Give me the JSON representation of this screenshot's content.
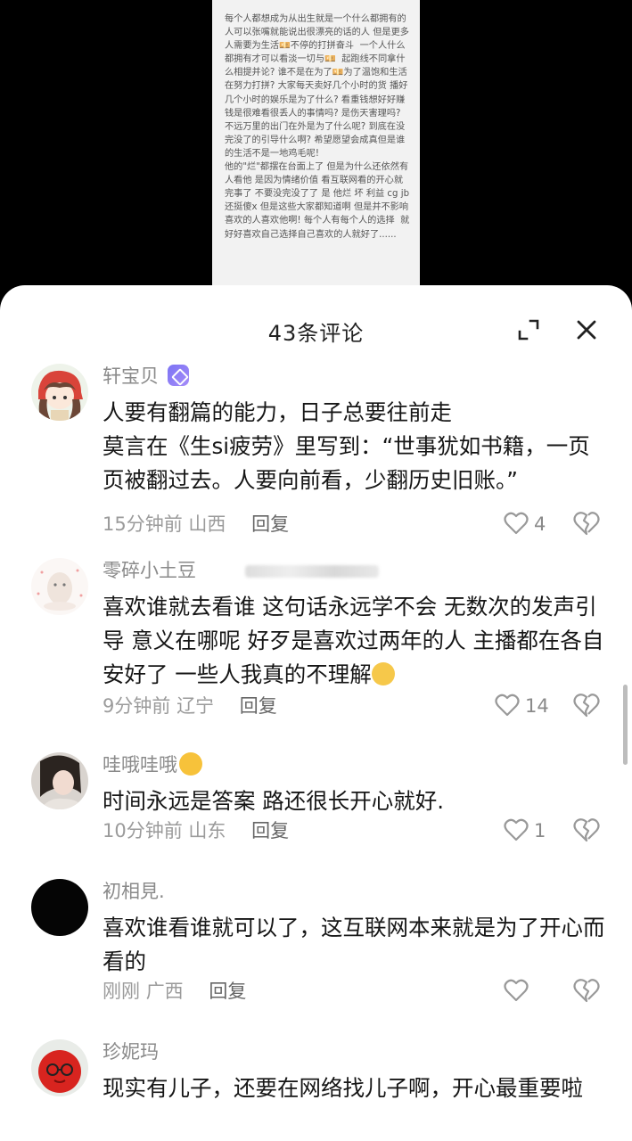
{
  "video": {
    "text": "每个人都想成为从出生就是一个什么都拥有的人可以张嘴就能说出很漂亮的话的人 但是更多人需要为生活💴不停的打拼奋斗  一个人什么都拥有才可以看淡一切与💴  起跑线不同拿什么相提并论? 谁不是在为了💴为了温饱和生活在努力打拼? 大家每天卖好几个小时的货 播好几个小时的娱乐是为了什么? 看重钱想好好赚钱是很难看很丢人的事情吗? 是伤天害理吗? 不远万里的出门在外是为了什么呢? 到底在没完没了的引导什么啊? 希望愿望会成真但是谁的生活不是一地鸡毛呢!\n他的\"烂\"都摆在台面上了 但是为什么还依然有人看他 是因为情绪价值 看互联网看的开心就完事了 不要没完没了了 是 他烂 坏 利益 cg jb 还挺傻x 但是这些大家都知道啊 但是并不影响喜欢的人喜欢他啊! 每个人有每个人的选择  就好好喜欢自己选择自己喜欢的人就好了......"
  },
  "sheet": {
    "title": "43条评论",
    "expand_icon": "expand-icon",
    "close_icon": "close-icon"
  },
  "comments": [
    {
      "username": "轩宝贝",
      "text": "人要有翻篇的能力，日子总要往前走\n莫言在《生si疲劳》里写到：“世事犹如书籍，一页页被翻过去。人要向前看，少翻历史旧账。”",
      "time": "15分钟前",
      "location": "山西",
      "reply": "回复",
      "likes": "4"
    },
    {
      "username": "零碎小土豆",
      "text": "喜欢谁就去看谁 这句话永远学不会 无数次的发声引导 意义在哪呢 好歹是喜欢过两年的人 主播都在各自安好了 一些人我真的不理解",
      "time": "9分钟前",
      "location": "辽宁",
      "reply": "回复",
      "likes": "14"
    },
    {
      "username": "哇哦哇哦",
      "text": "时间永远是答案 路还很长开心就好.",
      "time": "10分钟前",
      "location": "山东",
      "reply": "回复",
      "likes": "1"
    },
    {
      "username": "初相見.",
      "text": "喜欢谁看谁就可以了，这互联网本来就是为了开心而看的",
      "time": "刚刚",
      "location": "广西",
      "reply": "回复",
      "likes": ""
    },
    {
      "username": "珍妮玛",
      "text": "现实有儿子，还要在网络找儿子啊，开心最重要啦",
      "time": "",
      "location": "",
      "reply": "",
      "likes": ""
    }
  ],
  "colors": {
    "badge": "#8a7ff6",
    "background": "#ffffff",
    "text": "#161616",
    "muted": "#9b9b9b"
  }
}
